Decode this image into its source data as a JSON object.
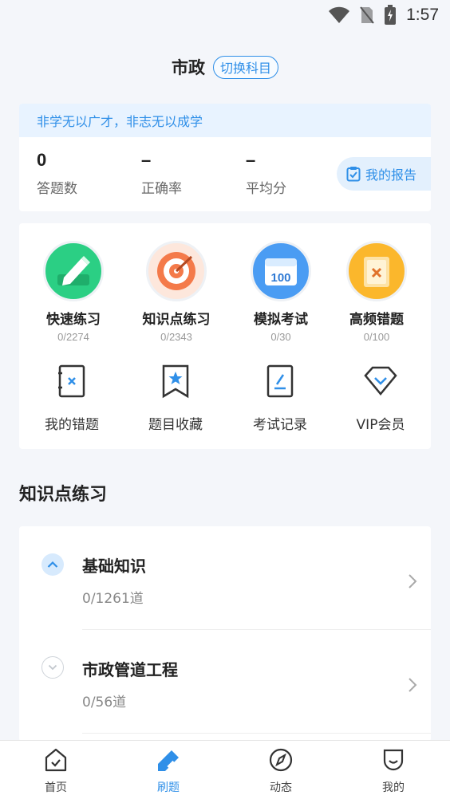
{
  "status_bar": {
    "time": "1:57"
  },
  "header": {
    "subject": "市政",
    "switch_label": "切换科目"
  },
  "stats": {
    "motto": "非学无以广才，非志无以成学",
    "items": [
      {
        "value": "0",
        "label": "答题数"
      },
      {
        "value": "–",
        "label": "正确率"
      },
      {
        "value": "–",
        "label": "平均分"
      }
    ],
    "report_label": "我的报告"
  },
  "features": [
    {
      "name": "快速练习",
      "count": "0/2274",
      "icon": "pencil-icon"
    },
    {
      "name": "知识点练习",
      "count": "0/2343",
      "icon": "target-icon"
    },
    {
      "name": "模拟考试",
      "count": "0/30",
      "icon": "calendar-100-icon"
    },
    {
      "name": "高频错题",
      "count": "0/100",
      "icon": "wrong-note-icon"
    }
  ],
  "tools": [
    {
      "name": "我的错题",
      "icon": "wrong-book-icon"
    },
    {
      "name": "题目收藏",
      "icon": "bookmark-star-icon"
    },
    {
      "name": "考试记录",
      "icon": "exam-record-icon"
    },
    {
      "name": "VIP会员",
      "icon": "diamond-icon"
    }
  ],
  "section_title": "知识点练习",
  "knowledge": [
    {
      "title": "基础知识",
      "progress": "0/1261道",
      "expanded": true
    },
    {
      "title": "市政管道工程",
      "progress": "0/56道",
      "expanded": false
    }
  ],
  "nav": [
    {
      "label": "首页",
      "icon": "home-icon",
      "active": false
    },
    {
      "label": "刷题",
      "icon": "practice-icon",
      "active": true
    },
    {
      "label": "动态",
      "icon": "compass-icon",
      "active": false
    },
    {
      "label": "我的",
      "icon": "profile-icon",
      "active": false
    }
  ],
  "colors": {
    "accent": "#2f8fe8",
    "background": "#f4f6fa"
  }
}
